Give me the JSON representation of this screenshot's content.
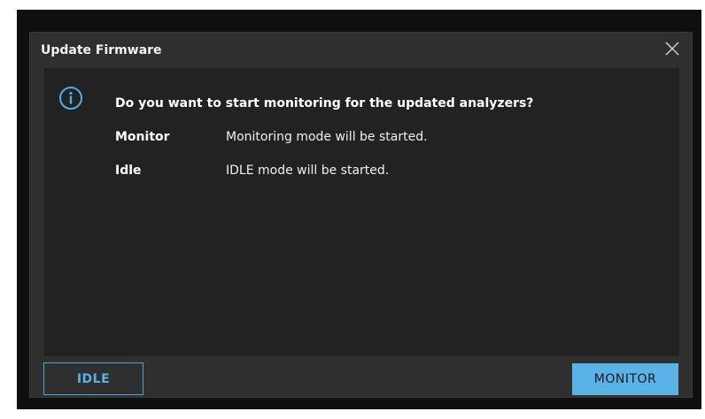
{
  "dialog": {
    "title": "Update Firmware",
    "question": "Do you want to start monitoring for the updated analyzers?",
    "options": [
      {
        "label": "Monitor",
        "description": "Monitoring mode will be started."
      },
      {
        "label": "Idle",
        "description": "IDLE mode will be started."
      }
    ],
    "buttons": {
      "idle": "IDLE",
      "monitor": "MONITOR"
    }
  },
  "colors": {
    "accent": "#59b3e6",
    "dialog_bg": "#2f2f2f",
    "content_bg": "#222222"
  },
  "icons": {
    "info": "info-icon",
    "close": "close-icon"
  }
}
